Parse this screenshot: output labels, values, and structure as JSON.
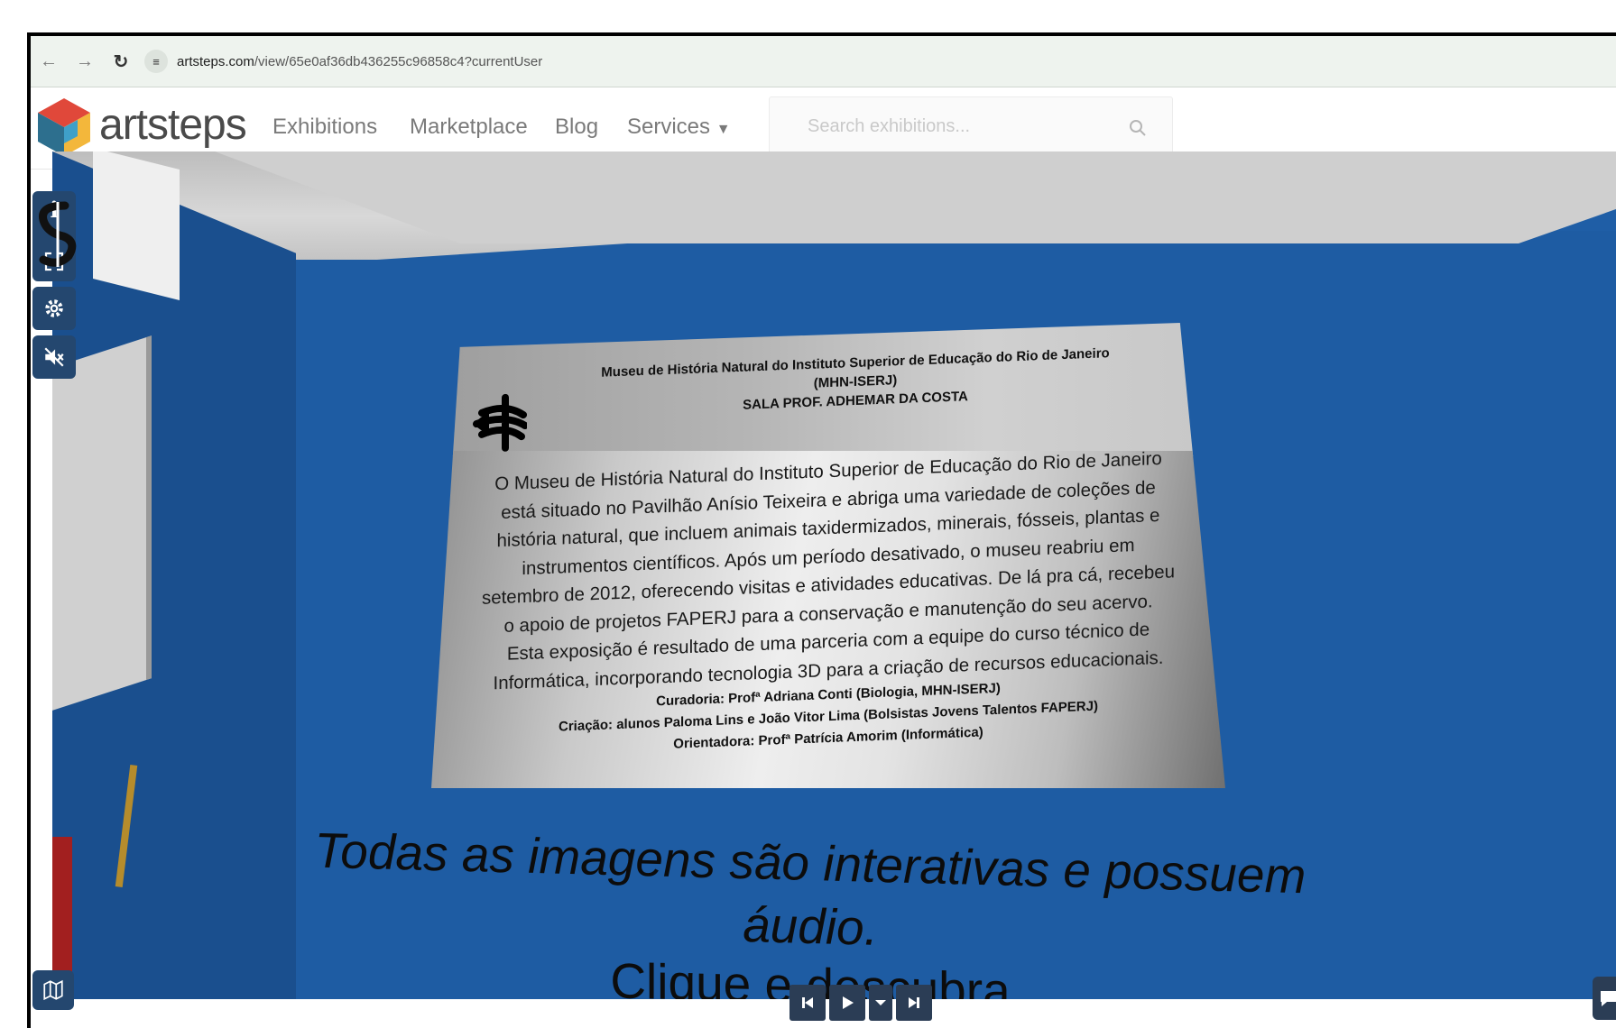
{
  "browser": {
    "url_domain": "artsteps.com",
    "url_path": "/view/65e0af36db436255c96858c4?currentUser",
    "back_icon": "arrow-left-icon",
    "forward_icon": "arrow-right-icon",
    "reload_icon": "reload-icon"
  },
  "header": {
    "brand": "artsteps",
    "menu": [
      "Exhibitions",
      "Marketplace",
      "Blog",
      "Services"
    ],
    "search_placeholder": "Search exhibitions..."
  },
  "board": {
    "title_lines": [
      "Museu de História Natural do Instituto Superior de Educação do Rio de Janeiro",
      "(MHN-ISERJ)",
      "SALA PROF. ADHEMAR DA COSTA"
    ],
    "text_lines": [
      "O Museu de História Natural do Instituto Superior de Educação do Rio de Janeiro",
      "está situado no Pavilhão Anísio Teixeira e abriga uma variedade de coleções de",
      "história natural, que incluem animais taxidermizados, minerais, fósseis, plantas e",
      "instrumentos científicos.  Após um período desativado, o museu reabriu em",
      "setembro de 2012, oferecendo visitas e atividades educativas. De lá pra cá, recebeu",
      "o apoio de projetos FAPERJ para a conservação e manutenção do seu acervo.",
      "Esta exposição é resultado de uma parceria com a equipe do curso técnico de",
      "Informática, incorporando tecnologia 3D para a criação de recursos educacionais."
    ],
    "credits": [
      "Curadoria: Profª Adriana Conti (Biologia, MHN-ISERJ)",
      "Criação: alunos Paloma Lins e João Vitor Lima (Bolsistas Jovens Talentos FAPERJ)",
      "Orientadora: Profª Patrícia Amorim (Informática)"
    ]
  },
  "banner": {
    "line1": "Todas as imagens são interativas e possuem áudio.",
    "line2": "Clique e descubra"
  },
  "toolbar": {
    "info_label": "i",
    "icons": [
      "info-icon",
      "music-icon",
      "fullscreen-icon",
      "gear-icon",
      "mute-icon",
      "map-icon"
    ]
  },
  "player": {
    "icons": [
      "skip-back-icon",
      "play-icon",
      "chevron-down-icon",
      "skip-forward-icon"
    ]
  },
  "colors": {
    "wall": "#1e5ca3",
    "toolbar": "#24476f",
    "player": "#2b3d55"
  }
}
